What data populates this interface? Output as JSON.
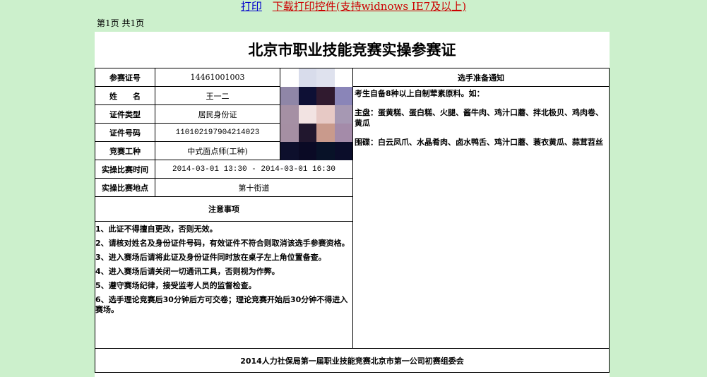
{
  "links": {
    "print": "打印",
    "download": "下载打印控件(支持widnows IE7及以上)"
  },
  "page_info": "第1页 共1页",
  "certificate": {
    "title": "北京市职业技能竞赛实操参赛证",
    "fields": [
      {
        "label": "参赛证号",
        "value": "14461001003"
      },
      {
        "label": "姓　　名",
        "value": "王一二"
      },
      {
        "label": "证件类型",
        "value": "居民身份证"
      },
      {
        "label": "证件号码",
        "value": "110102197904214023"
      },
      {
        "label": "竞赛工种",
        "value": "中式面点师(工种)"
      },
      {
        "label": "实操比赛时间",
        "value": "2014-03-01 13:30 - 2014-03-01 16:30"
      },
      {
        "label": "实操比赛地点",
        "value": "第十街道"
      }
    ],
    "notice": {
      "header": "选手准备通知",
      "paragraphs": [
        "考生自备8种以上自制荤素原料。如：",
        "主盘：蛋黄糕、蛋白糕、火腿、酱牛肉、鸡汁口蘑、拌北极贝、鸡肉卷、黄瓜",
        "围碟：白云凤爪、水晶肴肉、卤水鸭舌、鸡汁口蘑、蓑衣黄瓜、蒜茸苕丝"
      ]
    },
    "attention": {
      "header": "注意事项",
      "items": [
        "1、此证不得擅自更改，否则无效。",
        "2、请核对姓名及身份证件号码，有效证件不符合则取消该选手参赛资格。",
        "3、进入赛场后请将此证及身份证件同时放在桌子左上角位置备查。",
        "4、进入赛场后请关闭一切通讯工具，否则视为作弊。",
        "5、遵守赛场纪律，接受监考人员的监督检查。",
        "6、选手理论竞赛后30分钟后方可交卷；理论竞赛开始后30分钟不得进入赛场。"
      ]
    },
    "footer": "2014人力社保局第一届职业技能竞赛北京市第一公司初赛组委会"
  },
  "photo_colors": [
    [
      "#ffffff",
      "#d8dceb",
      "#dfe2ee",
      "#ffffff"
    ],
    [
      "#8f86a7",
      "#0e1035",
      "#301a2f",
      "#8a85b8"
    ],
    [
      "#a590a4",
      "#f2e3e2",
      "#e7c9c5",
      "#a698b3"
    ],
    [
      "#a58fa3",
      "#21172e",
      "#c99a8c",
      "#a48ba9"
    ],
    [
      "#0d0f2c",
      "#0a0a25",
      "#081228",
      "#0b0d2a"
    ]
  ]
}
